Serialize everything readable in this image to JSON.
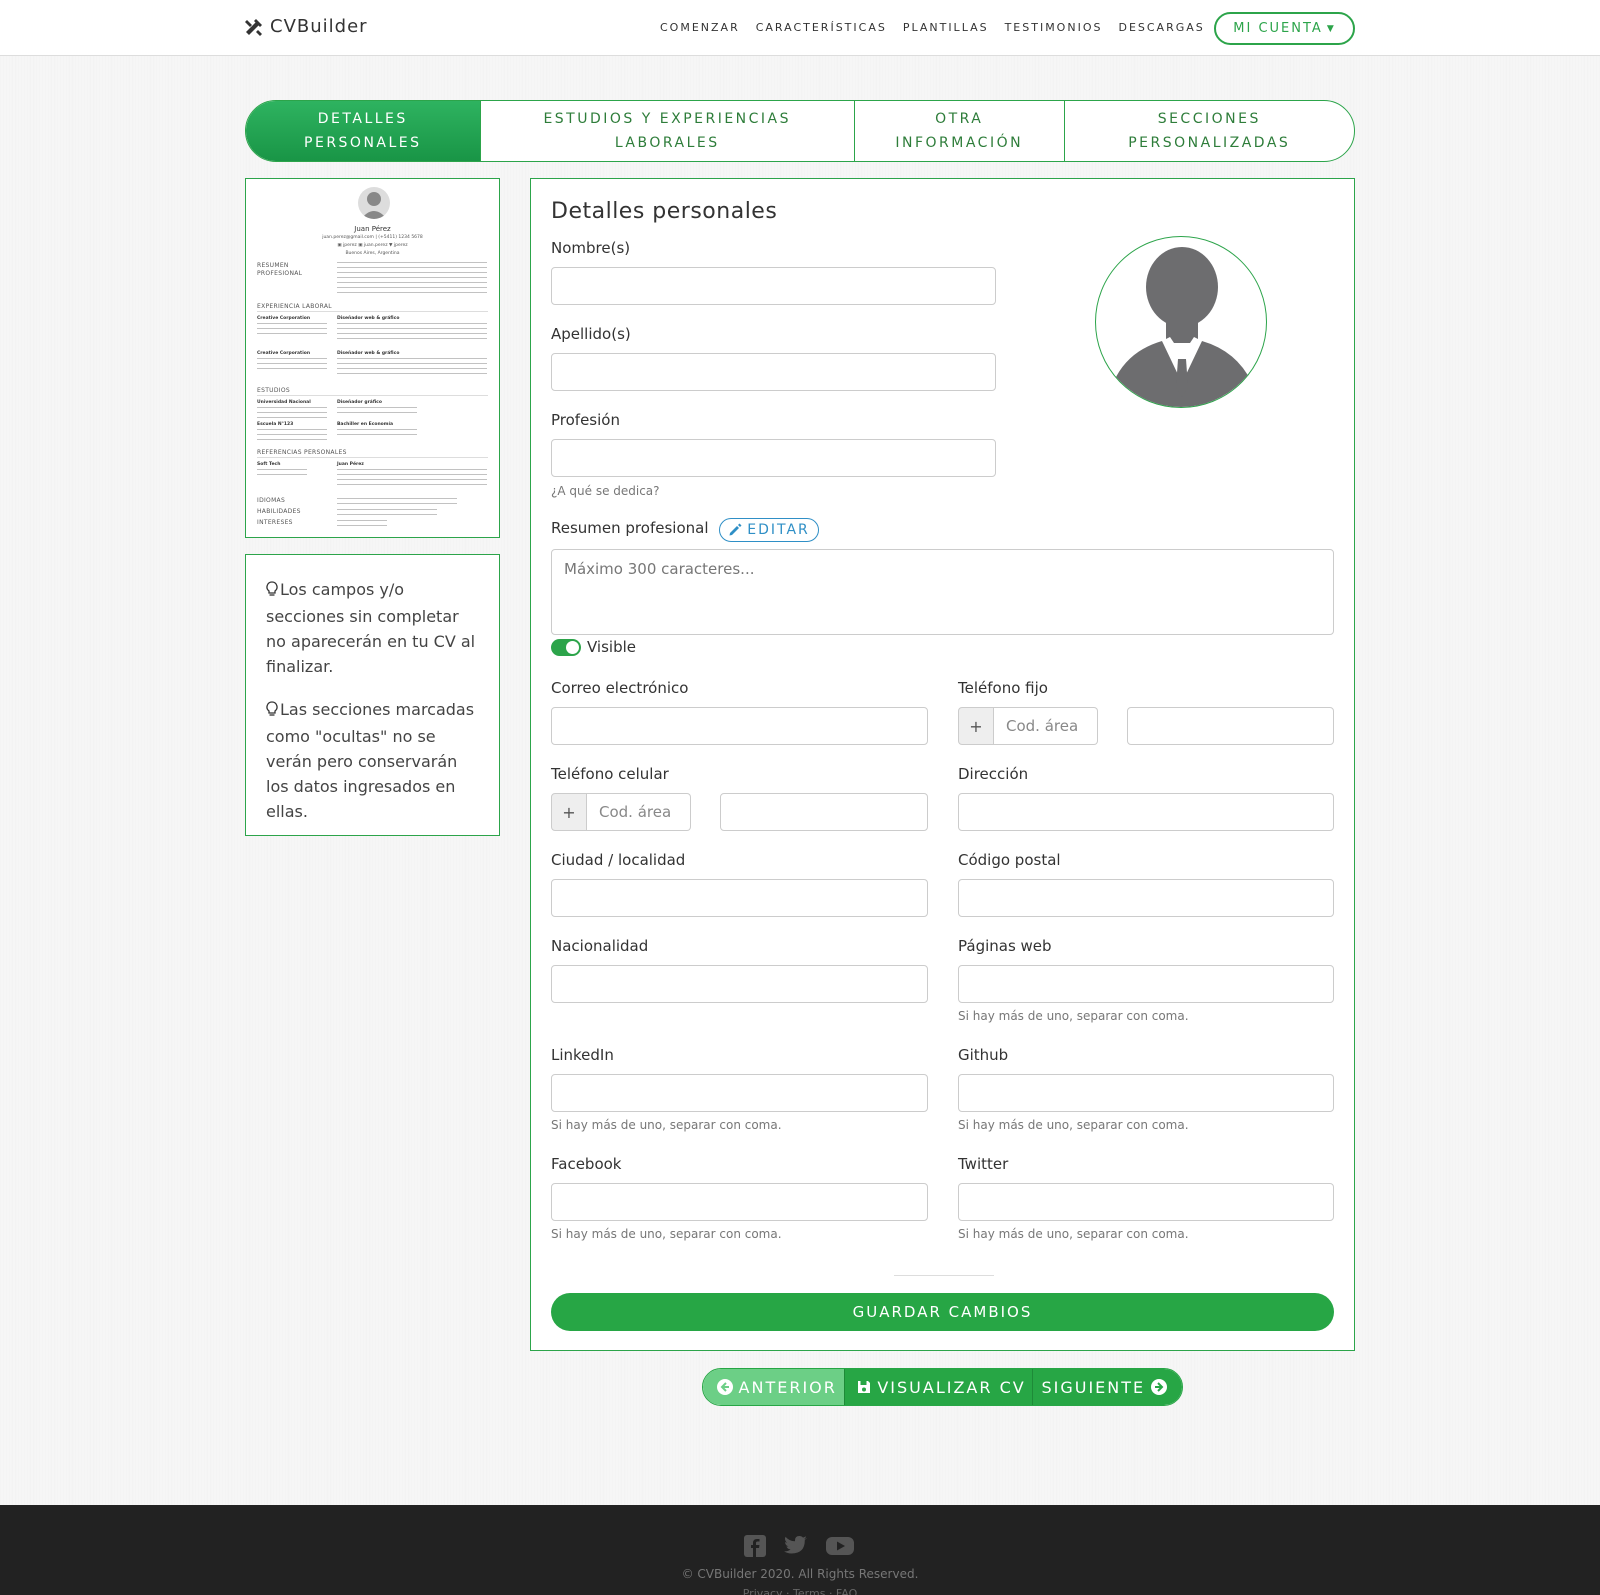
{
  "nav": {
    "brand": "CVBuilder",
    "links": [
      "COMENZAR",
      "CARACTERÍSTICAS",
      "PLANTILLAS",
      "TESTIMONIOS",
      "DESCARGAS"
    ],
    "account": "MI CUENTA"
  },
  "tabs": [
    {
      "label": "DETALLES\nPERSONALES",
      "active": true
    },
    {
      "label": "ESTUDIOS Y EXPERIENCIAS\nLABORALES",
      "active": false
    },
    {
      "label": "OTRA\nINFORMACIÓN",
      "active": false
    },
    {
      "label": "SECCIONES\nPERSONALIZADAS",
      "active": false
    }
  ],
  "preview": {
    "name": "Juan Pérez",
    "contact": "juan.perez@gmail.com | (+5411) 1234 5678",
    "social": "▣ jperez ▣ juan.perez ▼ jperez",
    "location": "Buenos Aires, Argentina",
    "sections": {
      "summary": "RESUMEN\nPROFESIONAL",
      "experience": "EXPERIENCIA LABORAL",
      "studies": "ESTUDIOS",
      "references": "REFERENCIAS PERSONALES",
      "languages": "IDIOMAS",
      "skills": "HABILIDADES",
      "interests": "INTERESES"
    },
    "jobs": [
      {
        "company": "Creative Corporation",
        "role": "Diseñador web & gráfico"
      },
      {
        "company": "Creative Corporation",
        "role": "Diseñador web & gráfico"
      }
    ],
    "schools": [
      {
        "school": "Universidad Nacional",
        "degree": "Diseñador gráfico"
      },
      {
        "school": "Escuela N°123",
        "degree": "Bachiller en Economía"
      }
    ],
    "reference": {
      "company": "Soft Tech",
      "name": "Juan Pérez"
    }
  },
  "tips": [
    "Los campos y/o secciones sin completar no aparecerán en tu CV al finalizar.",
    "Las secciones marcadas como \"ocultas\" no se verán pero conservarán los datos ingresados en ellas."
  ],
  "form": {
    "title": "Detalles personales",
    "nombre": "Nombre(s)",
    "apellido": "Apellido(s)",
    "profesion": "Profesión",
    "profesion_hint": "¿A qué se dedica?",
    "resumen": "Resumen profesional",
    "editar": "EDITAR",
    "resumen_placeholder": "Máximo 300 caracteres...",
    "visible": "Visible",
    "correo": "Correo electrónico",
    "telefono_fijo": "Teléfono fijo",
    "telefono_celular": "Teléfono celular",
    "direccion": "Dirección",
    "plus": "+",
    "cod_area": "Cod. área",
    "ciudad": "Ciudad / localidad",
    "codigo_postal": "Código postal",
    "nacionalidad": "Nacionalidad",
    "paginas_web": "Páginas web",
    "linkedin": "LinkedIn",
    "github": "Github",
    "facebook": "Facebook",
    "twitter": "Twitter",
    "multi_hint": "Si hay más de uno, separar con coma.",
    "guardar": "GUARDAR CAMBIOS"
  },
  "bottom_nav": {
    "prev": "ANTERIOR",
    "view": "VISUALIZAR CV",
    "next": "SIGUIENTE"
  },
  "footer": {
    "copyright": "© CVBuilder 2020. All Rights Reserved.",
    "links": "Privacy · Terms · FAQ"
  }
}
